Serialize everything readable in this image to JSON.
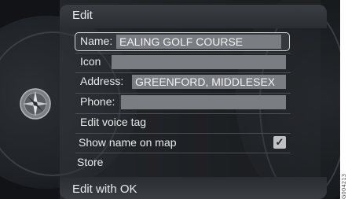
{
  "header": {
    "title": "Edit"
  },
  "form": {
    "name": {
      "label": "Name:",
      "value": "EALING GOLF COURSE"
    },
    "icon": {
      "label": "Icon",
      "value": ""
    },
    "address": {
      "label": "Address:",
      "value": "GREENFORD, MIDDLESEX"
    },
    "phone": {
      "label": "Phone:",
      "value": ""
    },
    "voice_tag": {
      "label": "Edit voice tag"
    },
    "show_name": {
      "label": "Show name on map",
      "checked": true,
      "check_glyph": "✓"
    },
    "store": {
      "label": "Store"
    }
  },
  "footer": {
    "hint": "Edit with OK"
  },
  "compass": {
    "icon": "compass-icon"
  },
  "figure_code": "G004213",
  "colors": {
    "background": "#111316",
    "field": "#7a7d82",
    "text": "#e9eaeb"
  }
}
